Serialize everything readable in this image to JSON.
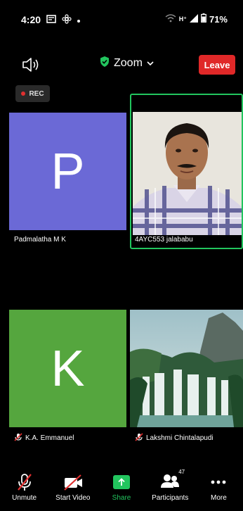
{
  "status_bar": {
    "time": "4:20",
    "network": "H⁺",
    "battery": "71%"
  },
  "header": {
    "meeting_title": "Zoom",
    "leave_label": "Leave"
  },
  "recording": {
    "label": "REC"
  },
  "participants": [
    {
      "name": "Padmalatha M K",
      "avatar_letter": "P",
      "avatar_color": "#6b69d6",
      "video": false,
      "muted": false
    },
    {
      "name": "4AYC553 jalababu",
      "video": true,
      "active_speaker": true,
      "muted": false
    },
    {
      "name": "K.A. Emmanuel",
      "avatar_letter": "K",
      "avatar_color": "#55a63e",
      "video": false,
      "muted": true
    },
    {
      "name": "Lakshmi Chintalapudi",
      "video": true,
      "muted": true
    }
  ],
  "toolbar": {
    "unmute": "Unmute",
    "start_video": "Start Video",
    "share": "Share",
    "participants": "Participants",
    "participants_count": "47",
    "more": "More"
  },
  "colors": {
    "leave": "#e02828",
    "active_border": "#22c55e",
    "share": "#22c55e"
  }
}
